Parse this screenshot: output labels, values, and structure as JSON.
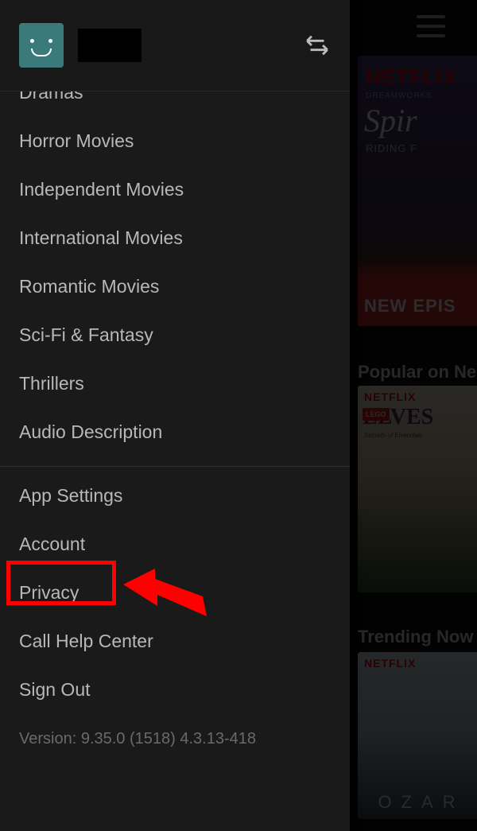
{
  "background": {
    "brand": "NETFLIX",
    "card1": {
      "studio": "DREAMWORKS",
      "title": "Spir",
      "subtitle": "RIDING F",
      "banner": "NEW EPIS"
    },
    "section1_title": "Popular on Ne",
    "card2": {
      "lego": "LEGO",
      "title": "ELVES",
      "subtitle": "Secrets of Elvendale"
    },
    "section2_title": "Trending Now",
    "card3": {
      "title": "OZAR"
    }
  },
  "drawer": {
    "categories": [
      "Dramas",
      "Horror Movies",
      "Independent Movies",
      "International Movies",
      "Romantic Movies",
      "Sci-Fi & Fantasy",
      "Thrillers",
      "Audio Description"
    ],
    "settings": [
      "App Settings",
      "Account",
      "Privacy",
      "Call Help Center",
      "Sign Out"
    ],
    "version": "Version: 9.35.0 (1518) 4.3.13-418"
  }
}
